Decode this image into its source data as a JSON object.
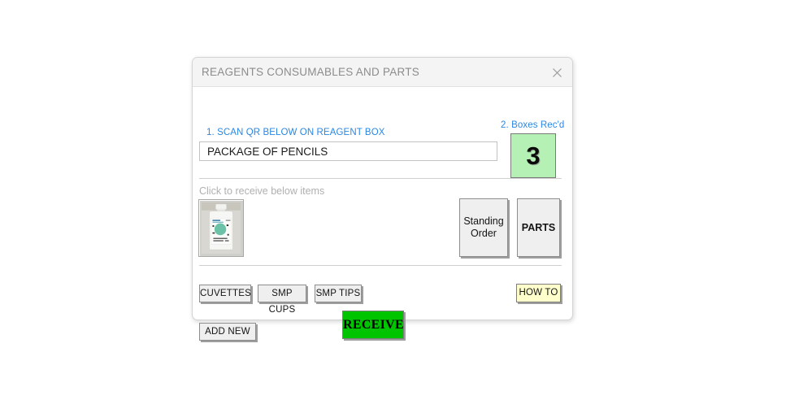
{
  "window": {
    "title": "REAGENTS CONSUMABLES AND PARTS",
    "close_icon": "close-icon"
  },
  "form": {
    "scan_label": "1. SCAN QR BELOW ON REAGENT BOX",
    "scan_value": "PACKAGE OF PENCILS",
    "scan_placeholder": "",
    "boxes_label": "2. Boxes Rec'd",
    "boxes_count": "3",
    "hint": "Click to receive below items"
  },
  "thumbnail": {
    "name": "reagent-bottle-thumbnail",
    "alt": "reagent bottle"
  },
  "buttons": {
    "standing_order": "Standing\nOrder",
    "standing_order_line1": "Standing",
    "standing_order_line2": "Order",
    "parts": "PARTS",
    "cuvettes": "CUVETTES",
    "smp_cups": "SMP CUPS",
    "smp_tips": "SMP TIPS",
    "add_new": "ADD NEW",
    "how_to": "HOW TO",
    "receive": "RECEIVE"
  },
  "colors": {
    "accent_blue": "#2b87e3",
    "boxes_green": "#b5f0b5",
    "receive_green": "#00c400",
    "howto_yellow": "#ffffcc",
    "titlebar": "#f4f4f4",
    "title_text": "#8c8c8c",
    "button_face": "#efefef"
  }
}
